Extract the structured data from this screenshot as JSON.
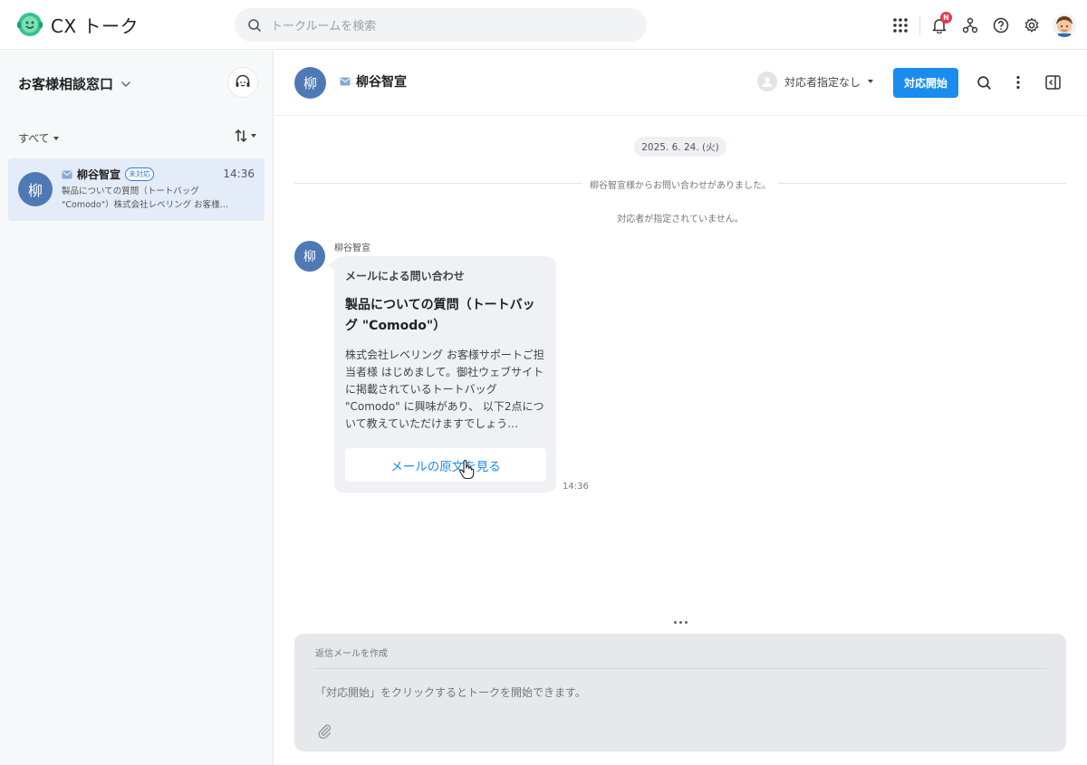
{
  "app": {
    "title": "CX トーク"
  },
  "search": {
    "placeholder": "トークルームを検索"
  },
  "topbar": {
    "icons": [
      "apps-grid-icon",
      "bell-icon",
      "org-chart-icon",
      "help-icon",
      "gear-icon",
      "user-avatar"
    ],
    "notification_badge": "N"
  },
  "sidebar": {
    "channel": "お客様相談窓口",
    "filter": "すべて",
    "conversations": [
      {
        "avatar": "柳",
        "name": "柳谷智宣",
        "status": "未対応",
        "time": "14:36",
        "preview": "製品についての質問（トートバッグ \"Comodo\"）株式会社レベリング お客様…"
      }
    ]
  },
  "chat": {
    "avatar": "柳",
    "name": "柳谷智宣",
    "assignee": "対応者指定なし",
    "start_button": "対応開始",
    "date": "2025. 6. 24. (火)",
    "system_messages": [
      "柳谷智宣様からお問い合わせがありました。",
      "対応者が指定されていません。"
    ],
    "message": {
      "sender": "柳谷智宣",
      "avatar": "柳",
      "label": "メールによる問い合わせ",
      "subject": "製品についての質問（トートバッグ \"Comodo\"）",
      "body": "株式会社レベリング お客様サポートご担当者様 はじめまして。御社ウェブサイトに掲載されているトートバッグ \"Comodo\" に興味があり、 以下2点について教えていただけますでしょう…",
      "button": "メールの原文を見る",
      "time": "14:36"
    }
  },
  "composer": {
    "title": "返信メールを作成",
    "placeholder": "「対応開始」をクリックするとトークを開始できます。"
  },
  "colors": {
    "accent": "#1a8cf0",
    "avatar": "#4f79b5",
    "selected_row": "#e3ecf8",
    "badge": "#e53950"
  }
}
